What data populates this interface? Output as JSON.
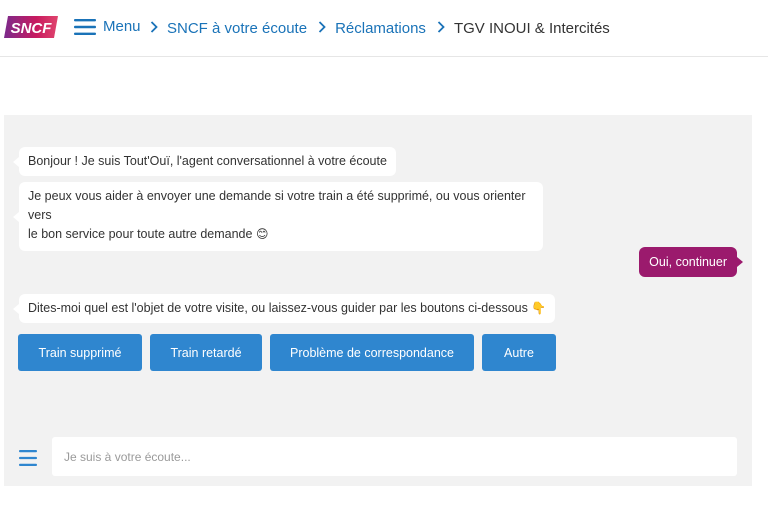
{
  "header": {
    "logo_text": "SNCF",
    "menu_label": "Menu",
    "breadcrumbs": [
      {
        "label": "SNCF à votre écoute"
      },
      {
        "label": "Réclamations"
      },
      {
        "label": "TGV INOUI & Intercités"
      }
    ]
  },
  "chat": {
    "messages": [
      {
        "from": "bot",
        "text": "Bonjour ! Je suis Tout'Ouï, l'agent conversationnel à votre écoute"
      },
      {
        "from": "bot",
        "text_line1": "Je peux vous aider à envoyer une demande si votre train a été supprimé, ou vous orienter vers",
        "text_line2": "le bon service pour toute autre demande",
        "emoji": "😊"
      },
      {
        "from": "user",
        "text": "Oui, continuer"
      },
      {
        "from": "bot",
        "text": "Dites-moi quel est l'objet de votre visite, ou laissez-vous guider par les boutons ci-dessous",
        "emoji": "👇"
      }
    ],
    "choices": [
      {
        "label": "Train supprimé"
      },
      {
        "label": "Train retardé"
      },
      {
        "label": "Problème de correspondance"
      },
      {
        "label": "Autre"
      }
    ],
    "input": {
      "placeholder": "Je suis à votre écoute...",
      "value": ""
    }
  },
  "colors": {
    "brand_blue": "#1a73b8",
    "button_blue": "#2f86cf",
    "user_bubble": "#9b1a6d",
    "panel_bg": "#f2f2f2"
  },
  "icons": {
    "logo": "sncf-logo",
    "menu": "hamburger-icon",
    "chevron": "chevron-right-icon",
    "input_menu": "hamburger-icon"
  }
}
